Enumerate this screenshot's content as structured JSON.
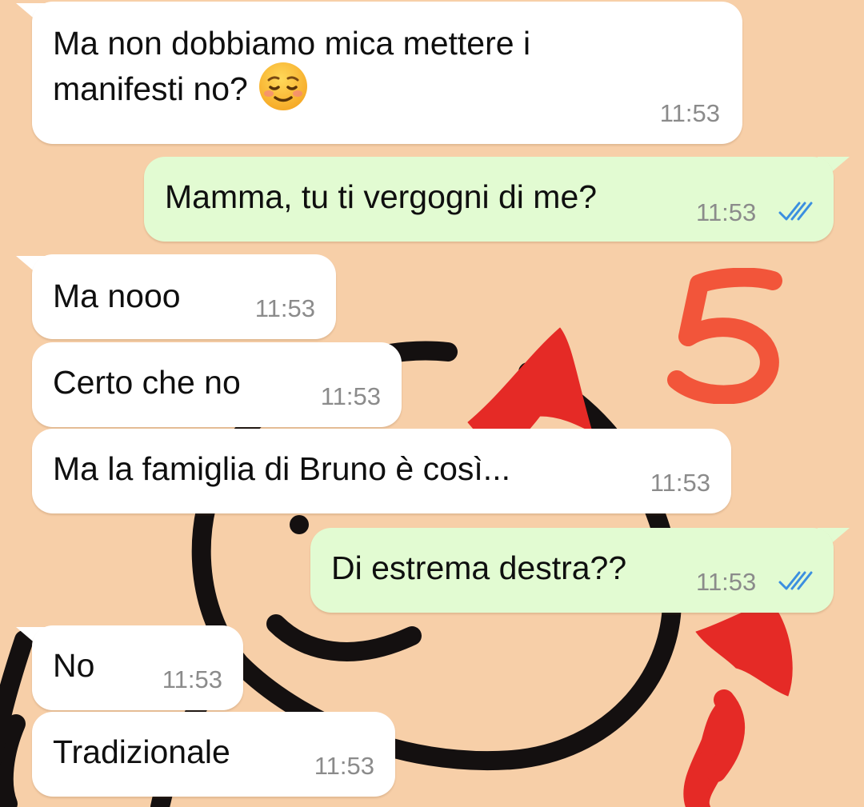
{
  "chat": {
    "messages": [
      {
        "direction": "incoming",
        "lines": [
          "Ma non dobbiamo mica mettere i",
          "manifesti no?"
        ],
        "emoji": "relieved-face",
        "time": "11:53"
      },
      {
        "direction": "outgoing",
        "text": "Mamma, tu ti vergogni di me?",
        "time": "11:53",
        "status": "read"
      },
      {
        "direction": "incoming",
        "text": "Ma nooo",
        "time": "11:53"
      },
      {
        "direction": "incoming",
        "text": "Certo che no",
        "time": "11:53"
      },
      {
        "direction": "incoming",
        "text": "Ma la famiglia di Bruno è così...",
        "time": "11:53"
      },
      {
        "direction": "outgoing",
        "text": "Di estrema destra??",
        "time": "11:53",
        "status": "read"
      },
      {
        "direction": "incoming",
        "text": "No",
        "time": "11:53"
      },
      {
        "direction": "incoming",
        "text": "Tradizionale",
        "time": "11:53"
      }
    ]
  },
  "overlay": {
    "number": "5",
    "color": "#f2553a"
  },
  "colors": {
    "wallpaper": "#f7cfa8",
    "incoming_bubble": "#ffffff",
    "outgoing_bubble": "#e2fbd2",
    "read_ticks": "#3b8fe0",
    "doodle_red": "#e52a26",
    "doodle_black": "#141010"
  }
}
